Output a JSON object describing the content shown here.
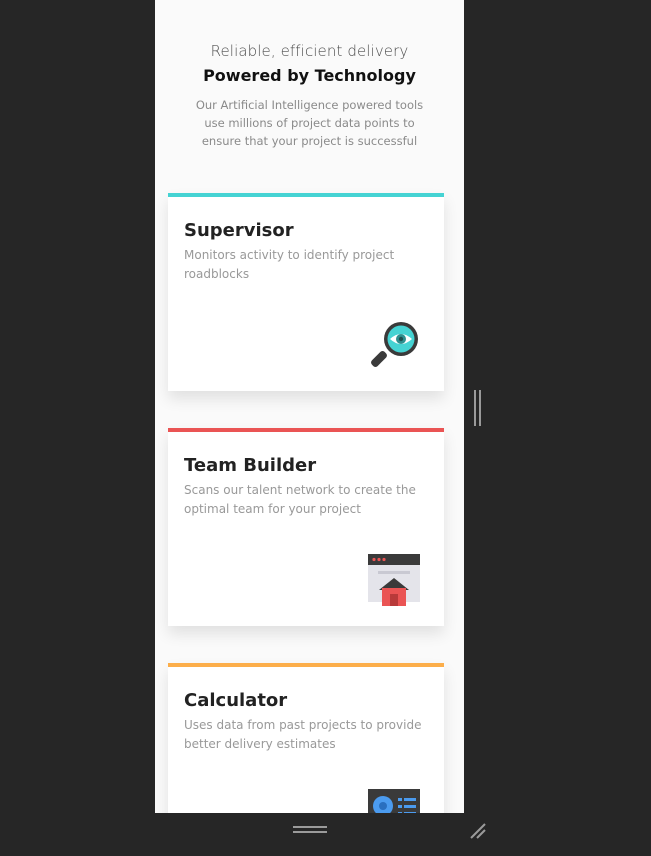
{
  "hero": {
    "subtitle": "Reliable, efficient delivery",
    "title": "Powered by Technology",
    "description": "Our Artificial Intelligence powered tools use millions of project data points to ensure that your project is successful"
  },
  "cards": [
    {
      "title": "Supervisor",
      "description": "Monitors activity to identify project roadblocks",
      "accent": "#45d3d3",
      "icon": "magnifier-eye-icon"
    },
    {
      "title": "Team Builder",
      "description": "Scans our talent network to create the optimal team for your project",
      "accent": "#ea5454",
      "icon": "browser-house-icon"
    },
    {
      "title": "Calculator",
      "description": "Uses data from past projects to provide better delivery estimates",
      "accent": "#fcae4a",
      "icon": "calculator-icon"
    }
  ],
  "colors": {
    "background": "#262626",
    "page": "#fafafa"
  }
}
